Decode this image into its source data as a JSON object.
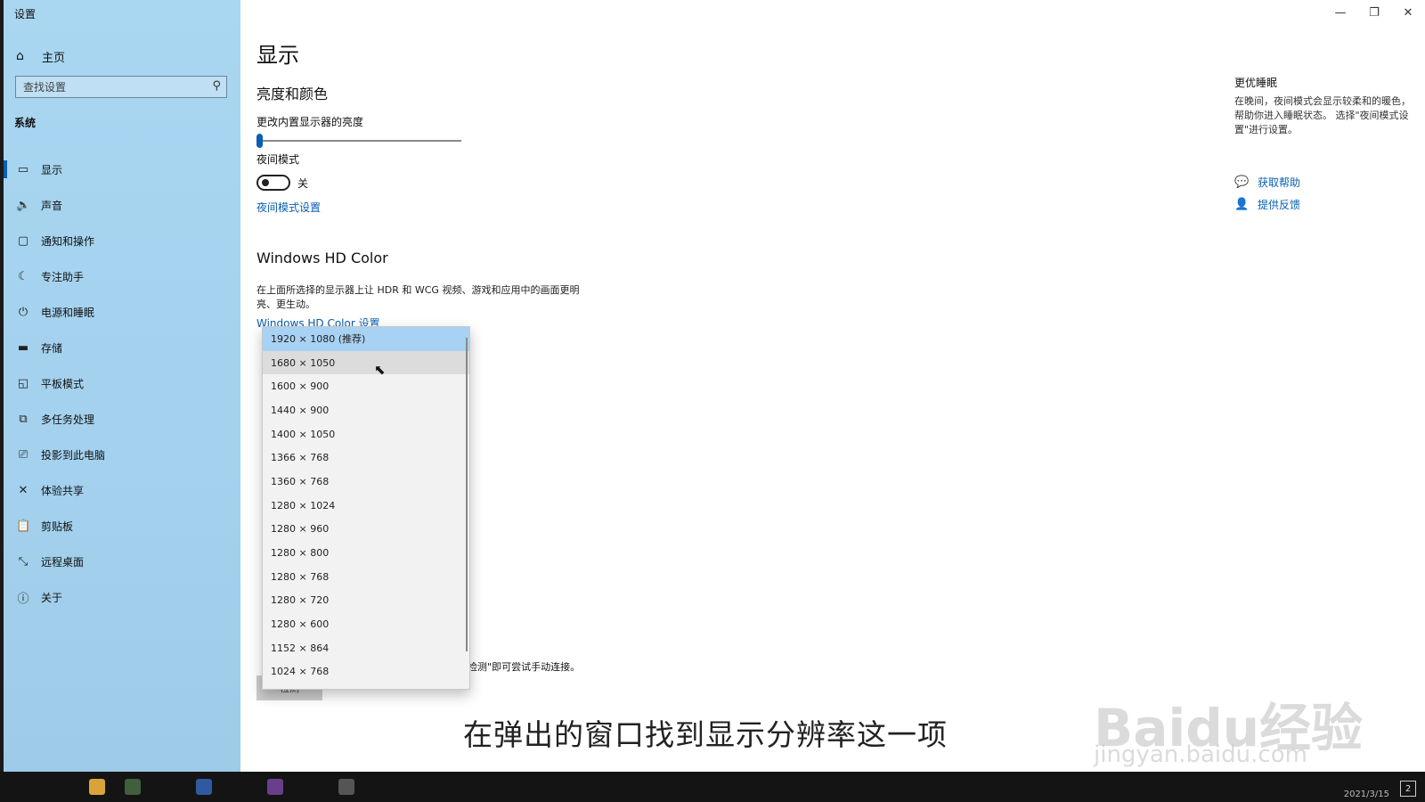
{
  "window": {
    "title": "设置"
  },
  "sidebar": {
    "home_label": "主页",
    "search_placeholder": "查找设置",
    "section_label": "系统",
    "items": [
      {
        "label": "显示",
        "icon": "monitor-icon"
      },
      {
        "label": "声音",
        "icon": "speaker-icon"
      },
      {
        "label": "通知和操作",
        "icon": "notification-icon"
      },
      {
        "label": "专注助手",
        "icon": "moon-icon"
      },
      {
        "label": "电源和睡眠",
        "icon": "power-icon"
      },
      {
        "label": "存储",
        "icon": "storage-icon"
      },
      {
        "label": "平板模式",
        "icon": "tablet-icon"
      },
      {
        "label": "多任务处理",
        "icon": "multitask-icon"
      },
      {
        "label": "投影到此电脑",
        "icon": "project-icon"
      },
      {
        "label": "体验共享",
        "icon": "share-icon"
      },
      {
        "label": "剪贴板",
        "icon": "clipboard-icon"
      },
      {
        "label": "远程桌面",
        "icon": "remote-desktop-icon"
      },
      {
        "label": "关于",
        "icon": "info-icon"
      }
    ]
  },
  "main": {
    "title": "显示",
    "brightness_heading": "亮度和颜色",
    "brightness_label": "更改内置显示器的亮度",
    "brightness_level": 0.0,
    "night_mode_label": "夜间模式",
    "night_mode_state": "关",
    "night_mode_settings_link": "夜间模式设置",
    "hd_heading": "Windows HD Color",
    "hd_desc": "在上面所选择的显示器上让 HDR 和 WCG 视频、游戏和应用中的画面更明亮、更生动。",
    "hd_link": "Windows HD Color 设置",
    "partial_text": "\"检测\"即可尝试手动连接。",
    "detect_button": "检测"
  },
  "dropdown": {
    "selected_index": 0,
    "hover_index": 1,
    "options": [
      "1920 × 1080 (推荐)",
      "1680 × 1050",
      "1600 × 900",
      "1440 × 900",
      "1400 × 1050",
      "1366 × 768",
      "1360 × 768",
      "1280 × 1024",
      "1280 × 960",
      "1280 × 800",
      "1280 × 768",
      "1280 × 720",
      "1280 × 600",
      "1152 × 864",
      "1024 × 768"
    ]
  },
  "right_panel": {
    "title": "更优睡眠",
    "desc": "在晚间，夜间模式会显示较柔和的暖色，帮助你进入睡眠状态。 选择\"夜间模式设置\"进行设置。",
    "help_link": "获取帮助",
    "feedback_link": "提供反馈"
  },
  "taskbar": {
    "date": "2021/3/15",
    "notification_count": "2"
  },
  "overlay": {
    "caption": "在弹出的窗口找到显示分辨率这一项",
    "watermark": "Baidu经验",
    "watermark_sub": "jingyan.baidu.com"
  },
  "colors": {
    "accent": "#0a5fb0",
    "sidebar": "#a6d3ef",
    "selected": "#a7d2f3"
  }
}
